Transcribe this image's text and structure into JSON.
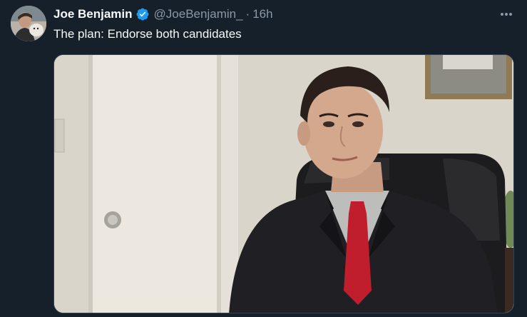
{
  "tweet": {
    "display_name": "Joe Benjamin",
    "handle": "@JoeBenjamin_",
    "separator": "·",
    "time": "16h",
    "text": "The plan: Endorse both candidates",
    "verified": true
  },
  "icons": {
    "avatar": "avatar-photo",
    "verified": "verified-badge-icon",
    "more": "more-options-icon"
  },
  "colors": {
    "background": "#15202b",
    "text_primary": "#f7f9f9",
    "text_secondary": "#8b98a5",
    "verified_blue": "#1d9bf0"
  }
}
